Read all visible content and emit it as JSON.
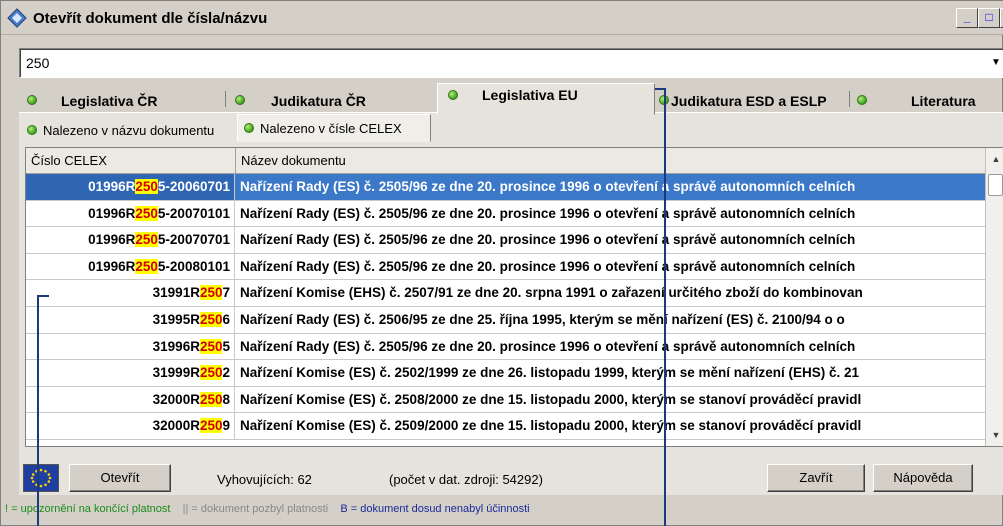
{
  "window": {
    "title": "Otevřít dokument dle čísla/názvu",
    "buttons": {
      "minimize": "_",
      "maximize": "□",
      "close": "X"
    }
  },
  "search": {
    "value": "250"
  },
  "tabs": [
    {
      "label": "Legislativa ČR",
      "active": false
    },
    {
      "label": "Judikatura ČR",
      "active": false
    },
    {
      "label": "Legislativa EU",
      "active": true
    },
    {
      "label": "Judikatura ESD a ESLP",
      "active": false
    },
    {
      "label": "Literatura",
      "active": false
    }
  ],
  "subtabs": [
    {
      "label": "Nalezeno v názvu dokumentu",
      "active": false
    },
    {
      "label": "Nalezeno v čísle CELEX",
      "active": true
    }
  ],
  "grid": {
    "columns": [
      "Číslo CELEX",
      "Název dokumentu"
    ],
    "rows": [
      {
        "code_pre": "01996R",
        "code_hl": "250",
        "code_post": "5-20060701",
        "name": "Nařízení Rady (ES) č. 2505/96 ze dne 20. prosince 1996 o otevření a správě autonomních celních",
        "selected": true
      },
      {
        "code_pre": "01996R",
        "code_hl": "250",
        "code_post": "5-20070101",
        "name": "Nařízení Rady (ES) č. 2505/96 ze dne 20. prosince 1996 o otevření a správě autonomních celních",
        "selected": false
      },
      {
        "code_pre": "01996R",
        "code_hl": "250",
        "code_post": "5-20070701",
        "name": "Nařízení Rady (ES) č. 2505/96 ze dne 20. prosince 1996 o otevření a správě autonomních celních",
        "selected": false
      },
      {
        "code_pre": "01996R",
        "code_hl": "250",
        "code_post": "5-20080101",
        "name": "Nařízení Rady (ES) č. 2505/96 ze dne 20. prosince 1996 o otevření a správě autonomních celních",
        "selected": false
      },
      {
        "code_pre": "31991R",
        "code_hl": "250",
        "code_post": "7",
        "name": "Nařízení Komise (EHS) č. 2507/91 ze dne 20. srpna 1991 o zařazení určitého zboží do kombinovan",
        "selected": false
      },
      {
        "code_pre": "31995R",
        "code_hl": "250",
        "code_post": "6",
        "name": "Nařízení Rady (ES) č. 2506/95 ze dne 25. října 1995, kterým se mění nařízení (ES) č. 2100/94 o o",
        "selected": false
      },
      {
        "code_pre": "31996R",
        "code_hl": "250",
        "code_post": "5",
        "name": "Nařízení Rady (ES) č. 2505/96 ze dne 20. prosince 1996 o otevření a správě autonomních celních",
        "selected": false
      },
      {
        "code_pre": "31999R",
        "code_hl": "250",
        "code_post": "2",
        "name": "Nařízení Komise (ES) č. 2502/1999 ze dne 26. listopadu 1999, kterým se mění nařízení (EHS) č. 21",
        "selected": false
      },
      {
        "code_pre": "32000R",
        "code_hl": "250",
        "code_post": "8",
        "name": "Nařízení Komise (ES) č. 2508/2000 ze dne 15. listopadu 2000, kterým se stanoví prováděcí pravidl",
        "selected": false
      },
      {
        "code_pre": "32000R",
        "code_hl": "250",
        "code_post": "9",
        "name": "Nařízení Komise (ES) č. 2509/2000 ze dne 15. listopadu 2000, kterým se stanoví prováděcí pravidl",
        "selected": false
      }
    ]
  },
  "footer": {
    "open_button": "Otevřít",
    "matches": "Vyhovujících: 62",
    "source_count": "(počet v dat. zdroji: 54292)",
    "close_button": "Zavřít",
    "help_button": "Nápověda"
  },
  "legend": {
    "expiring": "! = upozornění na končící platnost",
    "expired": "|| = dokument pozbyl platnosti",
    "not_effective": "B = dokument dosud nenabyl účinnosti"
  },
  "colors": {
    "selection": "#3c78c8",
    "highlight_bg": "#ffff00",
    "highlight_text": "#d40000",
    "tab_dot": "#39a020",
    "callout": "#1a3a7a"
  }
}
